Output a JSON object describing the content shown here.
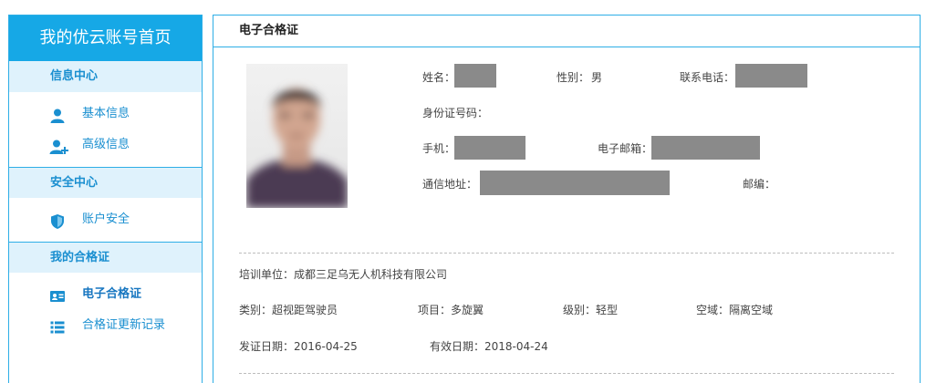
{
  "sidebar": {
    "header": "我的优云账号首页",
    "sections": [
      {
        "title": "信息中心",
        "items": [
          {
            "label": "基本信息",
            "icon": "user-icon"
          },
          {
            "label": "高级信息",
            "icon": "user-plus-icon"
          }
        ]
      },
      {
        "title": "安全中心",
        "items": [
          {
            "label": "账户安全",
            "icon": "shield-icon"
          }
        ]
      },
      {
        "title": "我的合格证",
        "items": [
          {
            "label": "电子合格证",
            "icon": "id-card-icon",
            "active": true
          },
          {
            "label": "合格证更新记录",
            "icon": "list-icon"
          }
        ]
      }
    ]
  },
  "main": {
    "title": "电子合格证",
    "personal": {
      "name_label": "姓名：",
      "gender_label": "性别：",
      "gender_value": "男",
      "phone_label": "联系电话：",
      "id_label": "身份证号码：",
      "mobile_label": "手机：",
      "email_label": "电子邮箱：",
      "address_label": "通信地址：",
      "zip_label": "邮编："
    },
    "cert": {
      "org_label": "培训单位：",
      "org_value": "成都三足乌无人机科技有限公司",
      "category_label": "类别：",
      "category_value": "超视距驾驶员",
      "project_label": "项目：",
      "project_value": "多旋翼",
      "level_label": "级别：",
      "level_value": "轻型",
      "airspace_label": "空域：",
      "airspace_value": "隔离空域",
      "issue_label": "发证日期：",
      "issue_value": "2016-04-25",
      "valid_label": "有效日期：",
      "valid_value": "2018-04-24"
    }
  },
  "colors": {
    "accent": "#16a8e6",
    "section_bg": "#dff2fc",
    "redaction": "#8a8a8a"
  }
}
